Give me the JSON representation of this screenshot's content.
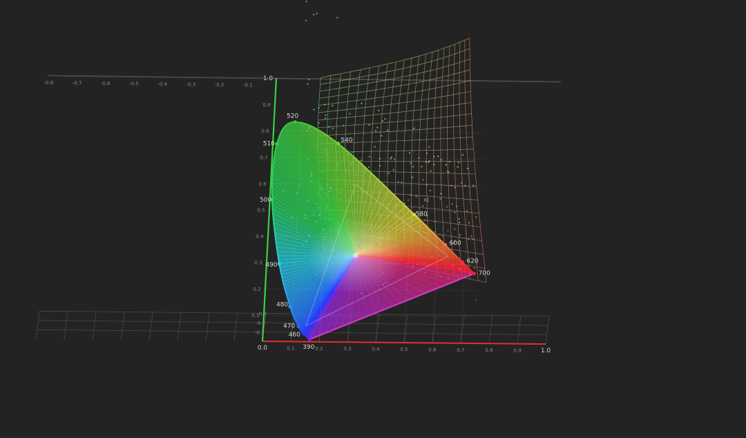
{
  "chart_data": {
    "type": "scatter",
    "title": "",
    "xlabel": "",
    "ylabel": "",
    "colors": {
      "background": "#232323",
      "grid": "#4a4a4a",
      "x_axis": "#e03030",
      "y_axis": "#3ed23e",
      "white_point": "#e8e8e8"
    },
    "grid": true,
    "x_axis": {
      "range": [
        -0.8,
        1.0
      ],
      "ticks": [
        "-0.8",
        "-0.7",
        "-0.6",
        "-0.5",
        "-0.4",
        "-0.3",
        "-0.2",
        "-0.1",
        "0.0",
        "0.1",
        "0.2",
        "0.3",
        "0.4",
        "0.5",
        "0.6",
        "0.7",
        "0.8",
        "0.9",
        "1.0"
      ]
    },
    "y_axis": {
      "range": [
        -0.3,
        1.0
      ],
      "ticks_positive": [
        "0.1",
        "0.2",
        "0.3",
        "0.4",
        "0.5",
        "0.6",
        "0.7",
        "0.8",
        "0.9",
        "1.0"
      ],
      "ticks_negative": [
        "-0.1",
        "-0.2",
        "-0.3"
      ]
    },
    "spectral_locus": [
      {
        "wavelength": "390",
        "x": 0.166,
        "y": 0.009
      },
      {
        "wavelength": "460",
        "x": 0.144,
        "y": 0.03
      },
      {
        "wavelength": "470",
        "x": 0.124,
        "y": 0.058
      },
      {
        "wavelength": "480",
        "x": 0.091,
        "y": 0.133
      },
      {
        "wavelength": "490",
        "x": 0.045,
        "y": 0.295
      },
      {
        "wavelength": "500",
        "x": 0.008,
        "y": 0.538
      },
      {
        "wavelength": "510",
        "x": 0.014,
        "y": 0.75
      },
      {
        "wavelength": "520",
        "x": 0.074,
        "y": 0.834
      },
      {
        "wavelength": "540",
        "x": 0.23,
        "y": 0.754
      },
      {
        "wavelength": "580",
        "x": 0.512,
        "y": 0.487
      },
      {
        "wavelength": "600",
        "x": 0.627,
        "y": 0.373
      },
      {
        "wavelength": "620",
        "x": 0.691,
        "y": 0.308
      },
      {
        "wavelength": "700",
        "x": 0.735,
        "y": 0.265
      }
    ],
    "white_point": {
      "x": 0.313,
      "y": 0.329
    }
  }
}
